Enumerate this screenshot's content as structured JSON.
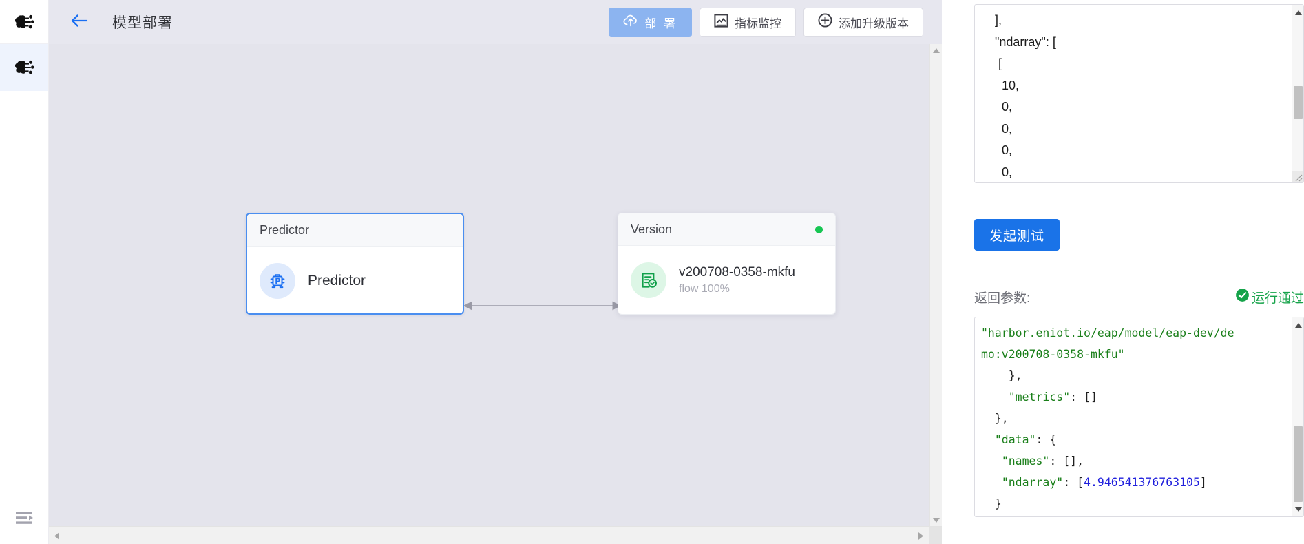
{
  "sidebar": {
    "logo_icon": "brain-network-icon",
    "items": [
      {
        "icon": "brain-network-icon",
        "name": "model-management",
        "active": true
      }
    ],
    "collapse_icon": "menu-expand-icon"
  },
  "header": {
    "back_icon": "arrow-left-icon",
    "title": "模型部署",
    "buttons": [
      {
        "name": "deploy",
        "label": "部 署",
        "icon": "cloud-upload-icon",
        "primary": true
      },
      {
        "name": "metrics-monitor",
        "label": "指标监控",
        "icon": "chart-box-icon",
        "primary": false
      },
      {
        "name": "add-upgrade-version",
        "label": "添加升级版本",
        "icon": "plus-circle-icon",
        "primary": false
      }
    ]
  },
  "canvas": {
    "nodes": [
      {
        "name": "predictor-node",
        "header": "Predictor",
        "icon": "predictor-icon",
        "title": "Predictor",
        "subtitle": "",
        "status": null,
        "selected": true
      },
      {
        "name": "version-node",
        "header": "Version",
        "icon": "version-doc-check-icon",
        "title": "v200708-0358-mkfu",
        "subtitle": "flow 100%",
        "status": "running",
        "selected": false
      }
    ],
    "connector": "bidirectional-arrow"
  },
  "right_panel": {
    "input_code": "    ],\n    \"ndarray\": [\n     [\n      10,\n      0,\n      0,\n      0,\n      0,\n      0",
    "test_button": "发起测试",
    "return_label": "返回参数:",
    "status_text": "运行通过",
    "status_icon": "check-circle-icon",
    "output_lines": [
      {
        "indent": 0,
        "parts": [
          {
            "t": "\"harbor.eniot.io/eap/model/eap-dev/de",
            "c": "jstr"
          }
        ]
      },
      {
        "indent": 0,
        "parts": [
          {
            "t": "mo:v200708-0358-mkfu\"",
            "c": "jstr"
          }
        ]
      },
      {
        "indent": 4,
        "parts": [
          {
            "t": "},",
            "c": "jpun"
          }
        ]
      },
      {
        "indent": 4,
        "parts": [
          {
            "t": "\"metrics\"",
            "c": "jkey"
          },
          {
            "t": ": []",
            "c": "jpun"
          }
        ]
      },
      {
        "indent": 2,
        "parts": [
          {
            "t": "},",
            "c": "jpun"
          }
        ]
      },
      {
        "indent": 2,
        "parts": [
          {
            "t": "\"data\"",
            "c": "jkey"
          },
          {
            "t": ": {",
            "c": "jpun"
          }
        ]
      },
      {
        "indent": 3,
        "parts": [
          {
            "t": "\"names\"",
            "c": "jkey"
          },
          {
            "t": ": [],",
            "c": "jpun"
          }
        ]
      },
      {
        "indent": 3,
        "parts": [
          {
            "t": "\"ndarray\"",
            "c": "jkey"
          },
          {
            "t": ": [",
            "c": "jpun"
          },
          {
            "t": "4.946541376763105",
            "c": "jnum"
          },
          {
            "t": "]",
            "c": "jpun"
          }
        ]
      },
      {
        "indent": 2,
        "parts": [
          {
            "t": "}",
            "c": "jpun"
          }
        ]
      },
      {
        "indent": 0,
        "parts": [
          {
            "t": "}",
            "c": "jpun jmatch"
          }
        ]
      }
    ]
  },
  "colors": {
    "accent_blue": "#1a73e8",
    "primary_button": "#8cb4f0",
    "canvas_bg": "#e4e4ec",
    "node_selected_border": "#4a8ef0",
    "status_green": "#17c653",
    "json_string": "#1a7f1a",
    "json_number": "#2020dd"
  }
}
